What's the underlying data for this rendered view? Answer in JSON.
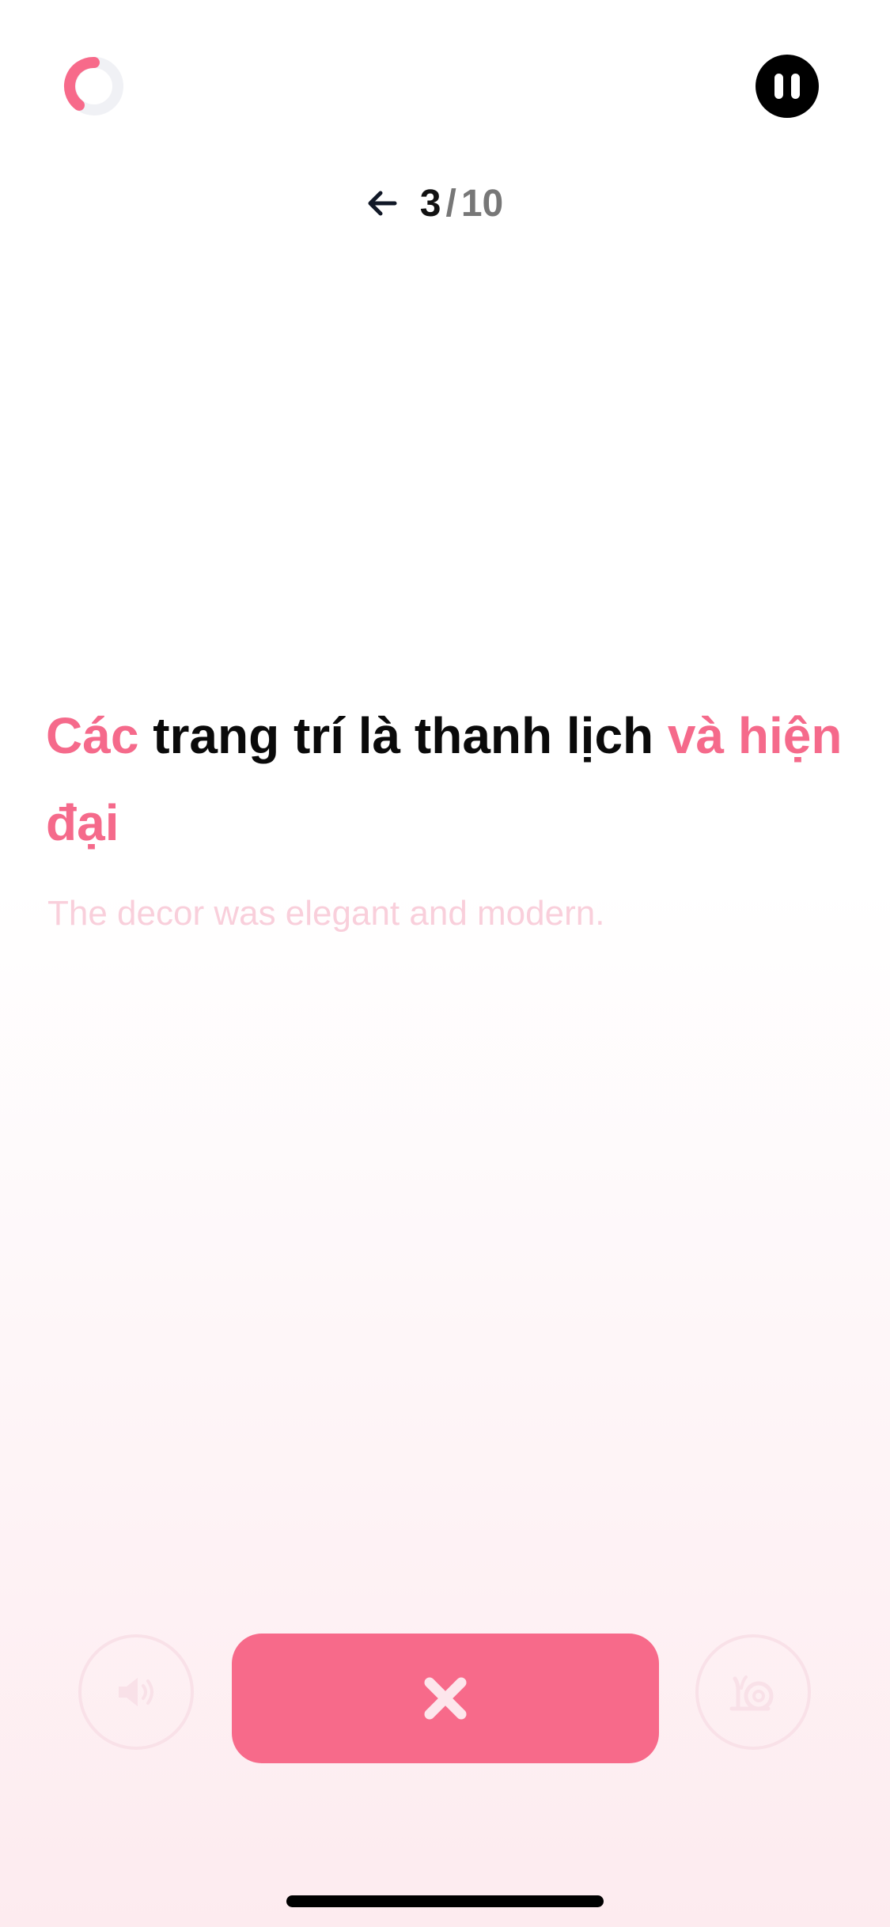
{
  "header": {
    "timer_icon": "countdown-ring-icon",
    "pause_icon": "pause-icon",
    "accent_color": "#f76a8a"
  },
  "progress": {
    "back_icon": "arrow-left-icon",
    "current": "3",
    "separator": "/",
    "total": "10"
  },
  "card": {
    "sentence_parts": [
      {
        "text": "Các",
        "highlight": true
      },
      {
        "text": " trang trí là thanh lịch ",
        "highlight": false
      },
      {
        "text": "và hiện đại",
        "highlight": true
      }
    ],
    "translation": "The decor was elegant and modern."
  },
  "controls": {
    "speaker_icon": "speaker-icon",
    "main_icon": "close-icon",
    "slow_icon": "snail-icon"
  }
}
